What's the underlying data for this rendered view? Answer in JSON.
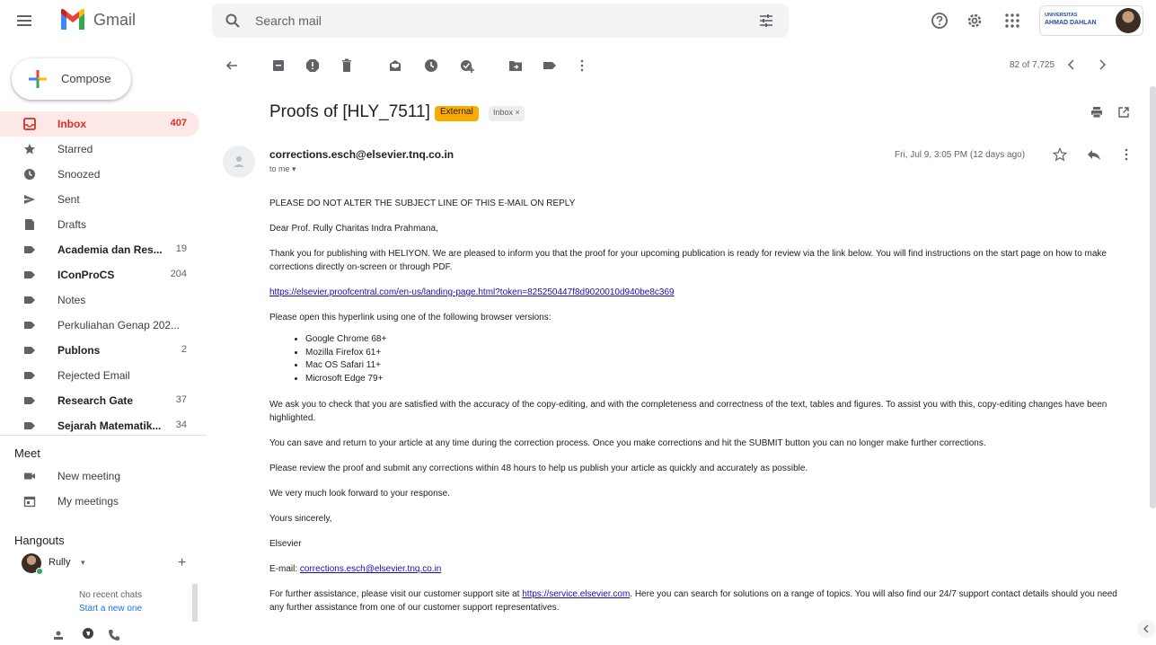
{
  "header": {
    "app_name": "Gmail",
    "search_placeholder": "Search mail",
    "org_logo_top": "UNIVERSITAS",
    "org_logo_name": "AHMAD DAHLAN",
    "accent": "#ea4335"
  },
  "compose_label": "Compose",
  "nav": [
    {
      "label": "Inbox",
      "count": "407",
      "icon": "inbox-icon",
      "active": true
    },
    {
      "label": "Starred",
      "count": "",
      "icon": "star-icon"
    },
    {
      "label": "Snoozed",
      "count": "",
      "icon": "clock-icon"
    },
    {
      "label": "Sent",
      "count": "",
      "icon": "send-icon"
    },
    {
      "label": "Drafts",
      "count": "",
      "icon": "draft-icon"
    },
    {
      "label": "Academia dan Res...",
      "count": "19",
      "icon": "label-icon",
      "bold": true
    },
    {
      "label": "IConProCS",
      "count": "204",
      "icon": "label-icon",
      "bold": true
    },
    {
      "label": "Notes",
      "count": "",
      "icon": "label-icon"
    },
    {
      "label": "Perkuliahan Genap 202...",
      "count": "",
      "icon": "label-icon"
    },
    {
      "label": "Publons",
      "count": "2",
      "icon": "label-icon",
      "bold": true
    },
    {
      "label": "Rejected Email",
      "count": "",
      "icon": "label-icon"
    },
    {
      "label": "Research Gate",
      "count": "37",
      "icon": "label-icon",
      "bold": true
    },
    {
      "label": "Sejarah Matematik...",
      "count": "34",
      "icon": "label-icon",
      "bold": true
    }
  ],
  "meet": {
    "header": "Meet",
    "new_meeting": "New meeting",
    "my_meetings": "My meetings"
  },
  "hangouts": {
    "header": "Hangouts",
    "user": "Rully",
    "no_chats": "No recent chats",
    "start": "Start a new one"
  },
  "pager": "82 of 7,725",
  "email": {
    "subject": "Proofs of [HLY_7511]",
    "badge_external": "External",
    "badge_inbox": "Inbox",
    "sender": "corrections.esch@elsevier.tnq.co.in",
    "to": "to me",
    "date": "Fri, Jul 9, 3:05 PM (12 days ago)",
    "p1": "PLEASE DO NOT ALTER THE SUBJECT LINE OF THIS E-MAIL ON REPLY",
    "p2": "Dear Prof. Rully Charitas Indra Prahmana,",
    "p3": "Thank you for publishing with HELIYON. We are pleased to inform you that the proof for your upcoming publication is ready for review via the link below. You will find instructions on the start page on how to make corrections directly on-screen or through PDF.",
    "link": "https://elsevier.proofcentral.com/en-us/landing-page.html?token=825250447f8d9020010d940be8c369",
    "p4": "Please open this hyperlink using one of the following browser versions:",
    "browsers": [
      "Google Chrome 68+",
      "Mozilla Firefox 61+",
      "Mac OS Safari 11+",
      "Microsoft Edge 79+"
    ],
    "p5": "We ask you to check that you are satisfied with the accuracy of the copy-editing, and with the completeness and correctness of the text, tables and figures. To assist you with this, copy-editing changes have been highlighted.",
    "p6": "You can save and return to your article at any time during the correction process. Once you make corrections and hit the SUBMIT button you can no longer make further corrections.",
    "p7": "Please review the proof and submit any corrections within 48 hours to help us publish your article as quickly and accurately as possible.",
    "p8": "We very much look forward to your response.",
    "p9": "Yours sincerely,",
    "p10": "Elsevier",
    "email_label": "E-mail: ",
    "email_link": "corrections.esch@elsevier.tnq.co.in",
    "p11_pre": "For further assistance, please visit our customer support site at ",
    "p11_link": "https://service.elsevier.com",
    "p11_post": ". Here you can search for solutions on a range of topics. You will also find our 24/7 support contact details should you need any further assistance from one of our customer support representatives."
  }
}
